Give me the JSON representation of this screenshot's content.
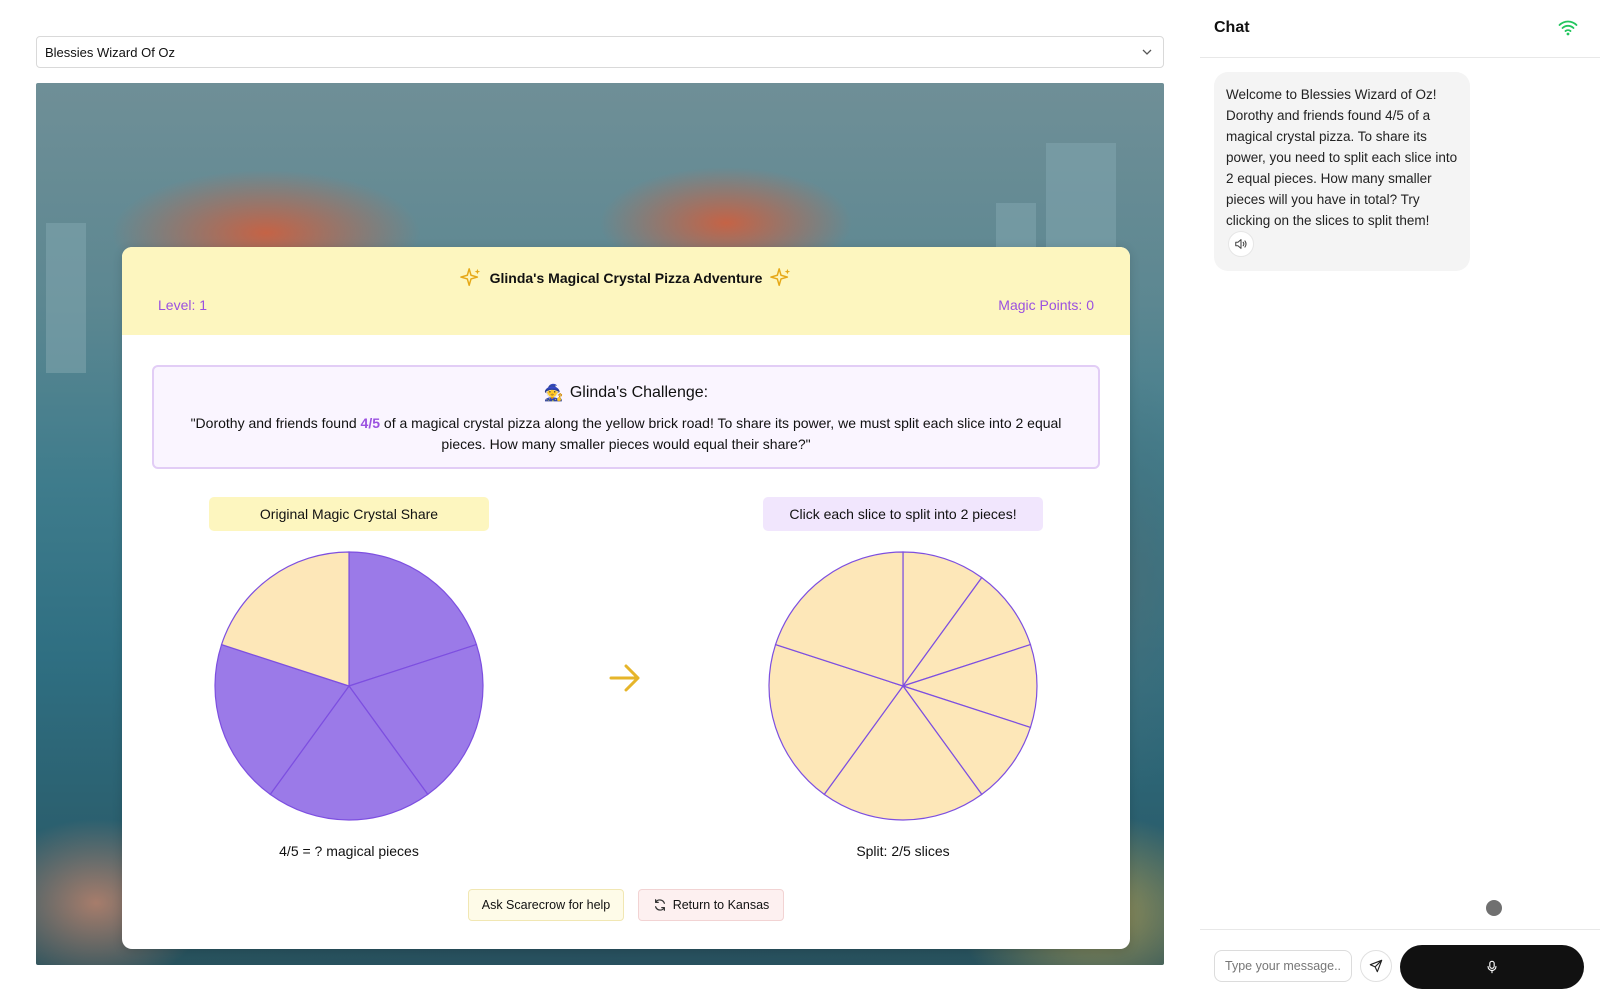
{
  "game_selector": {
    "value": "Blessies Wizard Of Oz"
  },
  "game": {
    "title": "Glinda's Magical Crystal Pizza Adventure",
    "level_label": "Level: 1",
    "points_label": "Magic Points: 0",
    "challenge": {
      "title": "Glinda's Challenge:",
      "emoji": "🧙",
      "text_before": "\"Dorothy and friends found ",
      "fraction": "4/5",
      "text_after": " of a magical crystal pizza along the yellow brick road! To share its power, we must split each slice into 2 equal pieces. How many smaller pieces would equal their share?\""
    },
    "left_label": "Original Magic Crystal Share",
    "right_label": "Click each slice to split into 2 pieces!",
    "left_caption": "4/5 = ? magical pieces",
    "right_caption": "Split: 2/5 slices",
    "help_button": "Ask Scarecrow for help",
    "return_button": "Return to Kansas",
    "colors": {
      "filled": "#9b7ae8",
      "empty": "#fde7b8",
      "outline": "#7d4fe0",
      "accent": "#e6b52a"
    }
  },
  "pies": {
    "original": {
      "total_slices": 5,
      "filled_slices": 4
    },
    "split": {
      "slices": [
        {
          "parts": 2
        },
        {
          "parts": 2
        },
        {
          "parts": 1
        },
        {
          "parts": 1
        },
        {
          "parts": 1
        }
      ]
    }
  },
  "chat": {
    "title": "Chat",
    "message": "Welcome to Blessies Wizard of Oz! Dorothy and friends found 4/5 of a magical crystal pizza. To share its power, you need to split each slice into 2 equal pieces. How many smaller pieces will you have in total? Try clicking on the slices to split them!",
    "input_placeholder": "Type your message..",
    "status_color": "#22c55e"
  }
}
